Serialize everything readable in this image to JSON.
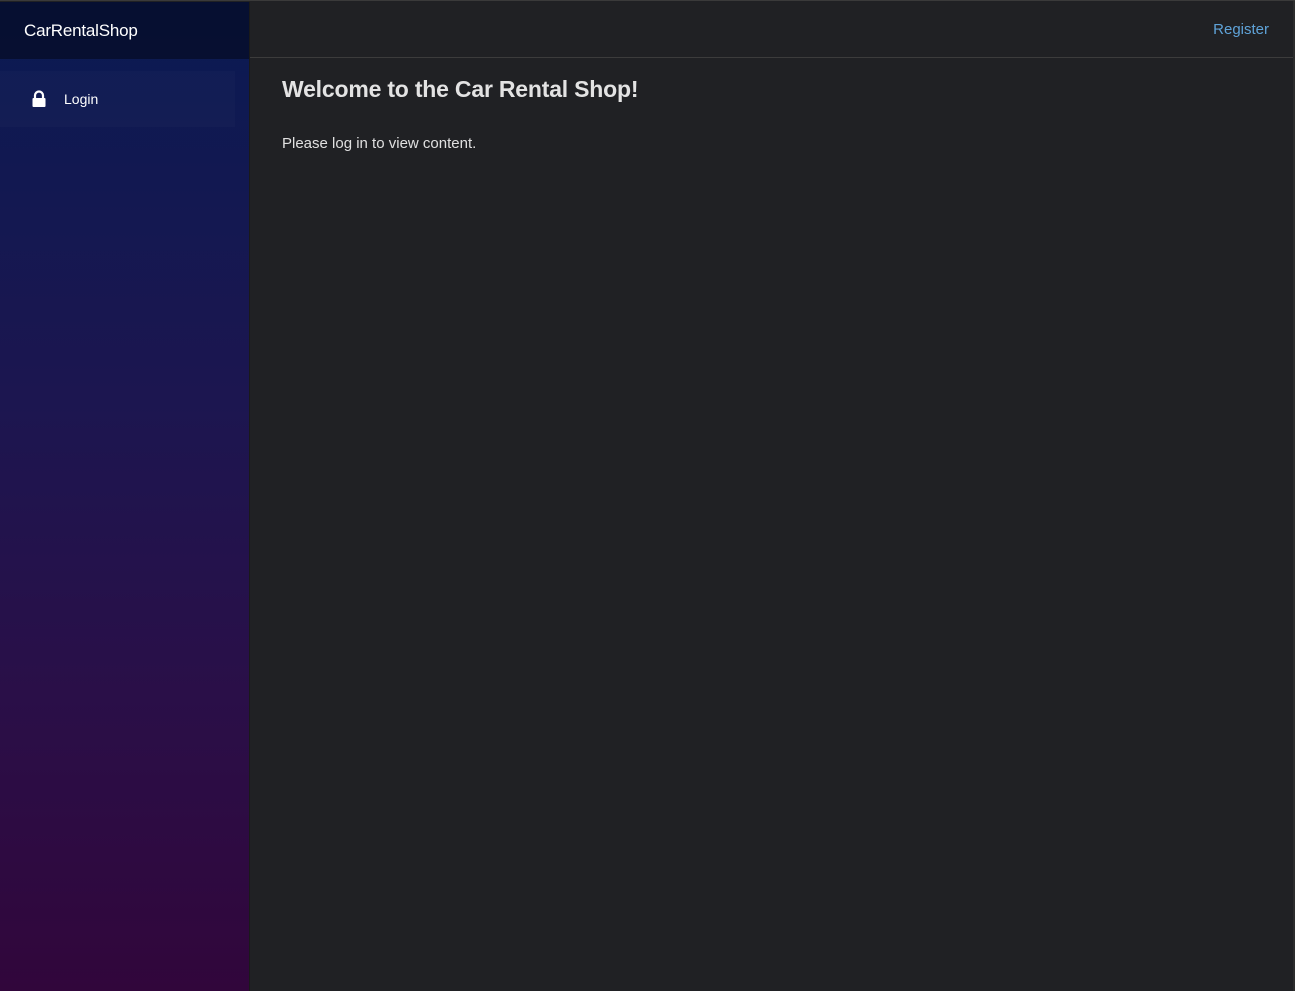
{
  "app": {
    "brand": "CarRentalShop"
  },
  "sidebar": {
    "items": [
      {
        "label": "Login",
        "icon": "lock-icon"
      }
    ]
  },
  "topbar": {
    "register_label": "Register"
  },
  "main": {
    "title": "Welcome to the Car Rental Shop!",
    "message": "Please log in to view content."
  },
  "colors": {
    "background": "#202124",
    "link": "#5fa3d8",
    "sidebar_top": "#0a1a52",
    "sidebar_bottom": "#31063b"
  }
}
